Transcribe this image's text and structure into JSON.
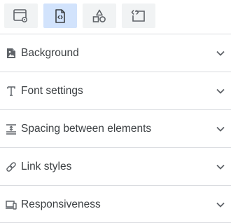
{
  "toolbar": {
    "buttons": [
      {
        "icon": "window-settings-icon",
        "active": false
      },
      {
        "icon": "code-file-icon",
        "active": true
      },
      {
        "icon": "shapes-icon",
        "active": false
      },
      {
        "icon": "code-box-icon",
        "active": false
      }
    ]
  },
  "panels": [
    {
      "icon": "background-image-icon",
      "label": "Background"
    },
    {
      "icon": "text-font-icon",
      "label": "Font settings"
    },
    {
      "icon": "spacing-icon",
      "label": "Spacing between elements"
    },
    {
      "icon": "link-icon",
      "label": "Link styles"
    },
    {
      "icon": "responsive-devices-icon",
      "label": "Responsiveness"
    }
  ],
  "colors": {
    "active_button": "#d2e3fc",
    "button": "#f1f3f4",
    "text": "#3c4043",
    "divider": "#dadce0",
    "icon": "#5f6368"
  }
}
